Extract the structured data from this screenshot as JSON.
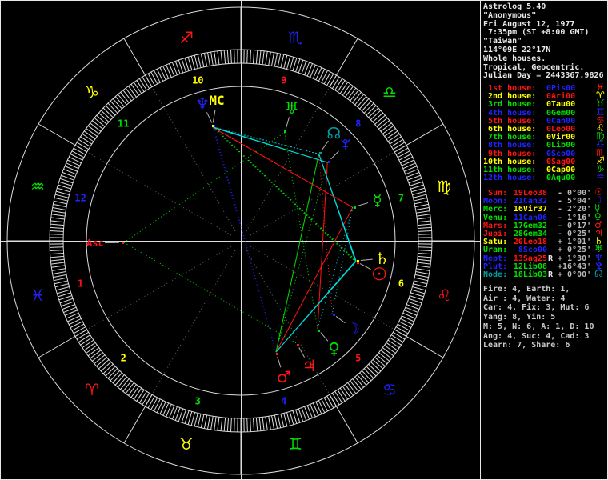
{
  "app": {
    "title": "Astrolog 5.40"
  },
  "panel": {
    "title_lines": [
      "Astrolog 5.40",
      "\"Anonymous\"",
      "Fri August 12, 1977",
      " 7:35pm (ST +8:00 GMT)",
      "\"Taiwan\"",
      "114°09E 22°17N",
      "Whole houses.",
      "Tropical, Geocentric.",
      "Julian Day = 2443367.9826"
    ],
    "houses": [
      {
        "label": " 1st house:",
        "value": "0Pis00",
        "glyph": "♓",
        "house_elem": "fire",
        "sign_elem": "water"
      },
      {
        "label": " 2nd house:",
        "value": "0Ari00",
        "glyph": "♈",
        "house_elem": "earth",
        "sign_elem": "fire"
      },
      {
        "label": " 3rd house:",
        "value": "0Tau00",
        "glyph": "♉",
        "house_elem": "air",
        "sign_elem": "earth"
      },
      {
        "label": " 4th house:",
        "value": "0Gem00",
        "glyph": "♊",
        "house_elem": "water",
        "sign_elem": "air"
      },
      {
        "label": " 5th house:",
        "value": "0Can00",
        "glyph": "♋",
        "house_elem": "fire",
        "sign_elem": "water"
      },
      {
        "label": " 6th house:",
        "value": "0Leo00",
        "glyph": "♌",
        "house_elem": "earth",
        "sign_elem": "fire"
      },
      {
        "label": " 7th house:",
        "value": "0Vir00",
        "glyph": "♍",
        "house_elem": "air",
        "sign_elem": "earth"
      },
      {
        "label": " 8th house:",
        "value": "0Lib00",
        "glyph": "♎",
        "house_elem": "water",
        "sign_elem": "air"
      },
      {
        "label": " 9th house:",
        "value": "0Sco00",
        "glyph": "♏",
        "house_elem": "fire",
        "sign_elem": "water"
      },
      {
        "label": "10th house:",
        "value": "0Sag00",
        "glyph": "♐",
        "house_elem": "earth",
        "sign_elem": "fire"
      },
      {
        "label": "11th house:",
        "value": "0Cap00",
        "glyph": "♑",
        "house_elem": "air",
        "sign_elem": "earth"
      },
      {
        "label": "12th house:",
        "value": "0Aqu00",
        "glyph": "♒",
        "house_elem": "water",
        "sign_elem": "air"
      }
    ],
    "planets": [
      {
        "label": " Sun:",
        "value": "19Leo38",
        "retro": "",
        "delta": "- 0°00'",
        "glyph": "☉",
        "color": "red",
        "value_elem": "fire"
      },
      {
        "label": "Moon:",
        "value": "21Can32",
        "retro": "",
        "delta": "- 5°04'",
        "glyph": "☽",
        "color": "blue",
        "value_elem": "water"
      },
      {
        "label": "Merc:",
        "value": "16Vir37",
        "retro": "",
        "delta": "- 2°20'",
        "glyph": "☿",
        "color": "green",
        "value_elem": "earth"
      },
      {
        "label": "Venu:",
        "value": "11Can06",
        "retro": "",
        "delta": "- 1°16'",
        "glyph": "♀",
        "color": "green",
        "value_elem": "water"
      },
      {
        "label": "Mars:",
        "value": "17Gem32",
        "retro": "",
        "delta": "- 0°17'",
        "glyph": "♂",
        "color": "red",
        "value_elem": "air"
      },
      {
        "label": "Jupi:",
        "value": "28Gem34",
        "retro": "",
        "delta": "- 0°25'",
        "glyph": "♃",
        "color": "red",
        "value_elem": "air"
      },
      {
        "label": "Satu:",
        "value": "20Leo18",
        "retro": "",
        "delta": "+ 1°01'",
        "glyph": "♄",
        "color": "yellow",
        "value_elem": "fire"
      },
      {
        "label": "Uran:",
        "value": " 8Sco00",
        "retro": "",
        "delta": "+ 0°25'",
        "glyph": "♅",
        "color": "green",
        "value_elem": "water"
      },
      {
        "label": "Nept:",
        "value": "13Sag25",
        "retro": "R",
        "delta": "+ 1°30'",
        "glyph": "♆",
        "color": "blue",
        "value_elem": "fire"
      },
      {
        "label": "Plut:",
        "value": "12Lib08",
        "retro": "",
        "delta": "+16°43'",
        "glyph": "pluto",
        "color": "blue",
        "value_elem": "air"
      },
      {
        "label": "Node:",
        "value": "18Lib03",
        "retro": "R",
        "delta": "+ 0°00'",
        "glyph": "☊",
        "color": "teal",
        "value_elem": "air"
      }
    ],
    "tallies": [
      "Fire: 4, Earth: 1,",
      "Air : 4, Water: 4",
      "Car: 4, Fix: 3, Mut: 6",
      "Yang: 8, Yin: 5",
      "M: 5, N: 6, A: 1, D: 10",
      "Ang: 4, Suc: 4, Cad: 3",
      "Learn: 7, Share: 6"
    ]
  },
  "chart": {
    "signs": [
      {
        "name": "Aries",
        "glyph": "♈",
        "elem": "fire"
      },
      {
        "name": "Taurus",
        "glyph": "♉",
        "elem": "earth"
      },
      {
        "name": "Gemini",
        "glyph": "♊",
        "elem": "air"
      },
      {
        "name": "Cancer",
        "glyph": "♋",
        "elem": "water"
      },
      {
        "name": "Leo",
        "glyph": "♌",
        "elem": "fire"
      },
      {
        "name": "Virgo",
        "glyph": "♍",
        "elem": "earth"
      },
      {
        "name": "Libra",
        "glyph": "♎",
        "elem": "air"
      },
      {
        "name": "Scorpio",
        "glyph": "♏",
        "elem": "water"
      },
      {
        "name": "Sagittarius",
        "glyph": "♐",
        "elem": "fire"
      },
      {
        "name": "Capricorn",
        "glyph": "♑",
        "elem": "earth"
      },
      {
        "name": "Aquarius",
        "glyph": "♒",
        "elem": "air"
      },
      {
        "name": "Pisces",
        "glyph": "♓",
        "elem": "water"
      }
    ],
    "house_elems": [
      "fire",
      "earth",
      "air",
      "water"
    ],
    "planets": [
      {
        "name": "Sun",
        "glyph": "sun",
        "color": "red",
        "lon": 139.63,
        "glyph_lon": 136.6
      },
      {
        "name": "Moon",
        "glyph": "☽",
        "color": "blue",
        "lon": 111.53,
        "glyph_lon": 111.9
      },
      {
        "name": "Mercury",
        "glyph": "☿",
        "color": "green",
        "lon": 166.62,
        "glyph_lon": 166.6
      },
      {
        "name": "Venus",
        "glyph": "♀",
        "color": "green",
        "lon": 101.1,
        "glyph_lon": 100.9
      },
      {
        "name": "Mars",
        "glyph": "♂",
        "color": "red",
        "lon": 77.53,
        "glyph_lon": 77.5
      },
      {
        "name": "Jupiter",
        "glyph": "♃",
        "color": "red",
        "lon": 88.57,
        "glyph_lon": 88.7
      },
      {
        "name": "Saturn",
        "glyph": "♄",
        "color": "yellow",
        "lon": 140.3,
        "glyph_lon": 142.9
      },
      {
        "name": "Uranus",
        "glyph": "♅",
        "color": "green",
        "lon": 218.0,
        "glyph_lon": 219.0
      },
      {
        "name": "Neptune",
        "glyph": "♆",
        "color": "blue",
        "lon": 253.42,
        "glyph_lon": 255.6
      },
      {
        "name": "Pluto",
        "glyph": "pluto",
        "color": "blue",
        "lon": 192.13,
        "glyph_lon": 192.7
      },
      {
        "name": "Node",
        "glyph": "☊",
        "color": "teal",
        "lon": 198.05,
        "glyph_lon": 199.2
      },
      {
        "name": "MC",
        "glyph": "MC",
        "color": "yellow",
        "lon": 253.87,
        "glyph_lon": 249.7,
        "text": true,
        "size": 16
      },
      {
        "name": "Asc",
        "glyph": "Asc",
        "color": "red",
        "lon": 330.82,
        "glyph_lon": 330.9,
        "text": true,
        "size": 12,
        "glyph_r": 182
      }
    ],
    "aspects": [
      [
        "Sun",
        "Saturn",
        "yellow",
        false
      ],
      [
        "MC",
        "Neptune",
        "yellow",
        false
      ],
      [
        "Node",
        "Mars",
        "green",
        false
      ],
      [
        "Mercury",
        "Mars",
        "red",
        false
      ],
      [
        "Pluto",
        "Venus",
        "red",
        false
      ],
      [
        "MC",
        "Mercury",
        "red",
        false
      ],
      [
        "Neptune",
        "Pluto",
        "cyan",
        false
      ],
      [
        "MC",
        "Pluto",
        "cyan",
        false
      ],
      [
        "Sun",
        "Mars",
        "cyan",
        false
      ],
      [
        "Saturn",
        "Mars",
        "cyan",
        false
      ],
      [
        "Sun",
        "Node",
        "cyan",
        false
      ],
      [
        "Saturn",
        "Node",
        "cyan",
        false
      ],
      [
        "Neptune",
        "Sun",
        "green",
        true
      ],
      [
        "Neptune",
        "Saturn",
        "green",
        true
      ],
      [
        "MC",
        "Sun",
        "green",
        true
      ],
      [
        "MC",
        "Saturn",
        "green",
        true
      ],
      [
        "Uranus",
        "Venus",
        "green",
        true
      ],
      [
        "Pluto",
        "Mars",
        "green",
        true
      ],
      [
        "Asc",
        "Uranus",
        "green",
        true
      ],
      [
        "Asc",
        "Jupiter",
        "green",
        true
      ],
      [
        "Neptune",
        "Mercury",
        "red",
        true
      ],
      [
        "Moon",
        "Node",
        "red",
        true
      ],
      [
        "Mercury",
        "Moon",
        "cyan",
        true
      ],
      [
        "Mercury",
        "Venus",
        "cyan",
        true
      ],
      [
        "MC",
        "Node",
        "cyan",
        true
      ],
      [
        "Neptune",
        "Node",
        "cyan",
        true
      ],
      [
        "MC",
        "Mars",
        "blue",
        true
      ],
      [
        "Neptune",
        "Mars",
        "blue",
        true
      ]
    ],
    "palette": {
      "red": "#ff1414",
      "yellow": "#ffff00",
      "green": "#00e000",
      "blue": "#2222ff",
      "cyan": "#00dcdc",
      "teal": "#00a0a0",
      "white": "#e8e8e8",
      "gray": "#9a9a9a",
      "dim": "#707070",
      "line": "#dcdcdc"
    }
  }
}
